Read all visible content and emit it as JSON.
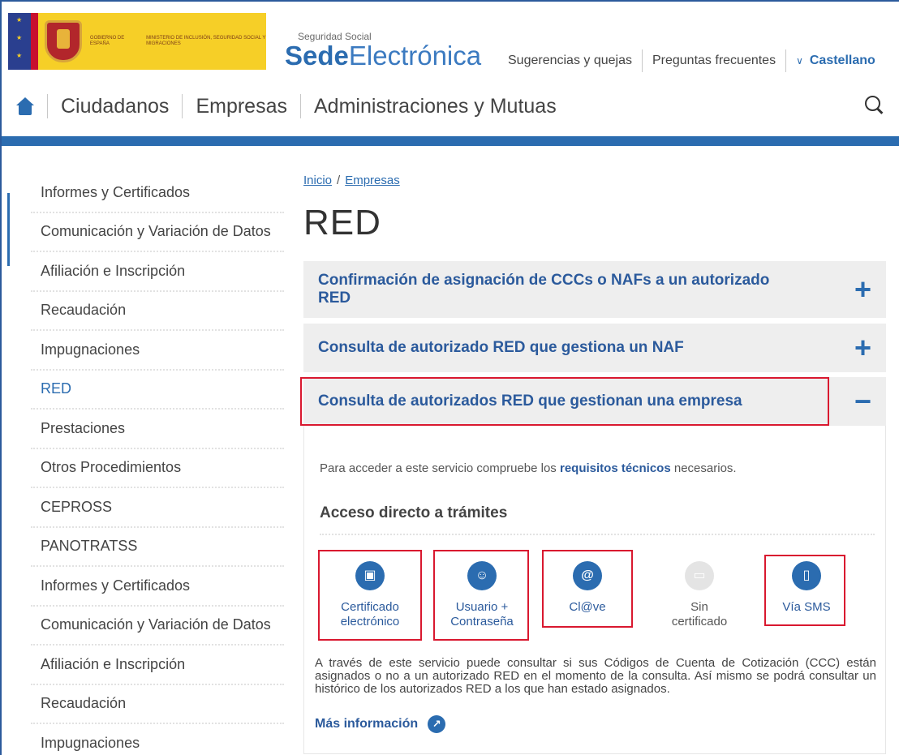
{
  "header": {
    "gob_text": "GOBIERNO DE ESPAÑA",
    "ministry_text": "MINISTERIO DE INCLUSIÓN, SEGURIDAD SOCIAL Y MIGRACIONES",
    "sede_small": "Seguridad Social",
    "sede_bold": "Sede",
    "sede_light": "Electrónica",
    "links": [
      "Sugerencias y quejas",
      "Preguntas frecuentes"
    ],
    "language": "Castellano"
  },
  "nav": {
    "items": [
      "Ciudadanos",
      "Empresas",
      "Administraciones y Mutuas"
    ]
  },
  "sidebar": {
    "items": [
      "Informes y Certificados",
      "Comunicación y Variación de Datos",
      "Afiliación e Inscripción",
      "Recaudación",
      "Impugnaciones",
      "RED",
      "Prestaciones",
      "Otros Procedimientos",
      "CEPROSS",
      "PANOTRATSS",
      "Informes y Certificados",
      "Comunicación y Variación de Datos",
      "Afiliación e Inscripción",
      "Recaudación",
      "Impugnaciones"
    ]
  },
  "breadcrumb": {
    "home": "Inicio",
    "separator": "/",
    "current": "Empresas"
  },
  "page_title": "RED",
  "accordions": [
    {
      "title": "Confirmación de asignación de CCCs o NAFs a un autorizado RED",
      "icon": "+"
    },
    {
      "title": "Consulta de autorizado RED que gestiona un NAF",
      "icon": "+"
    },
    {
      "title": "Consulta de autorizados RED que gestionan una empresa",
      "icon": "−"
    }
  ],
  "panel": {
    "req_prefix": "Para acceder a este servicio compruebe los ",
    "req_link": "requisitos técnicos",
    "req_suffix": " necesarios.",
    "access_title": "Acceso directo a trámites",
    "tiles": [
      {
        "line1": "Certificado",
        "line2": "electrónico",
        "icon": "laptop-lock-icon"
      },
      {
        "line1": "Usuario +",
        "line2": "Contraseña",
        "icon": "user-lock-icon"
      },
      {
        "line1": "Cl@ve",
        "line2": "",
        "icon": "at-icon"
      },
      {
        "line1": "Sin",
        "line2": "certificado",
        "icon": "laptop-icon"
      },
      {
        "line1": "Vía SMS",
        "line2": "",
        "icon": "mobile-icon"
      }
    ],
    "description": "A través de este servicio puede consultar si sus Códigos de Cuenta de Cotización (CCC) están asignados o no a un autorizado RED en el momento de la consulta. Así mismo se podrá consultar un histórico de los autorizados RED a los que han estado asignados.",
    "more_info": "Más información"
  },
  "colors": {
    "brand_blue": "#2b6cb0",
    "highlight_red": "#d9182f",
    "gov_yellow": "#f6cf27"
  }
}
